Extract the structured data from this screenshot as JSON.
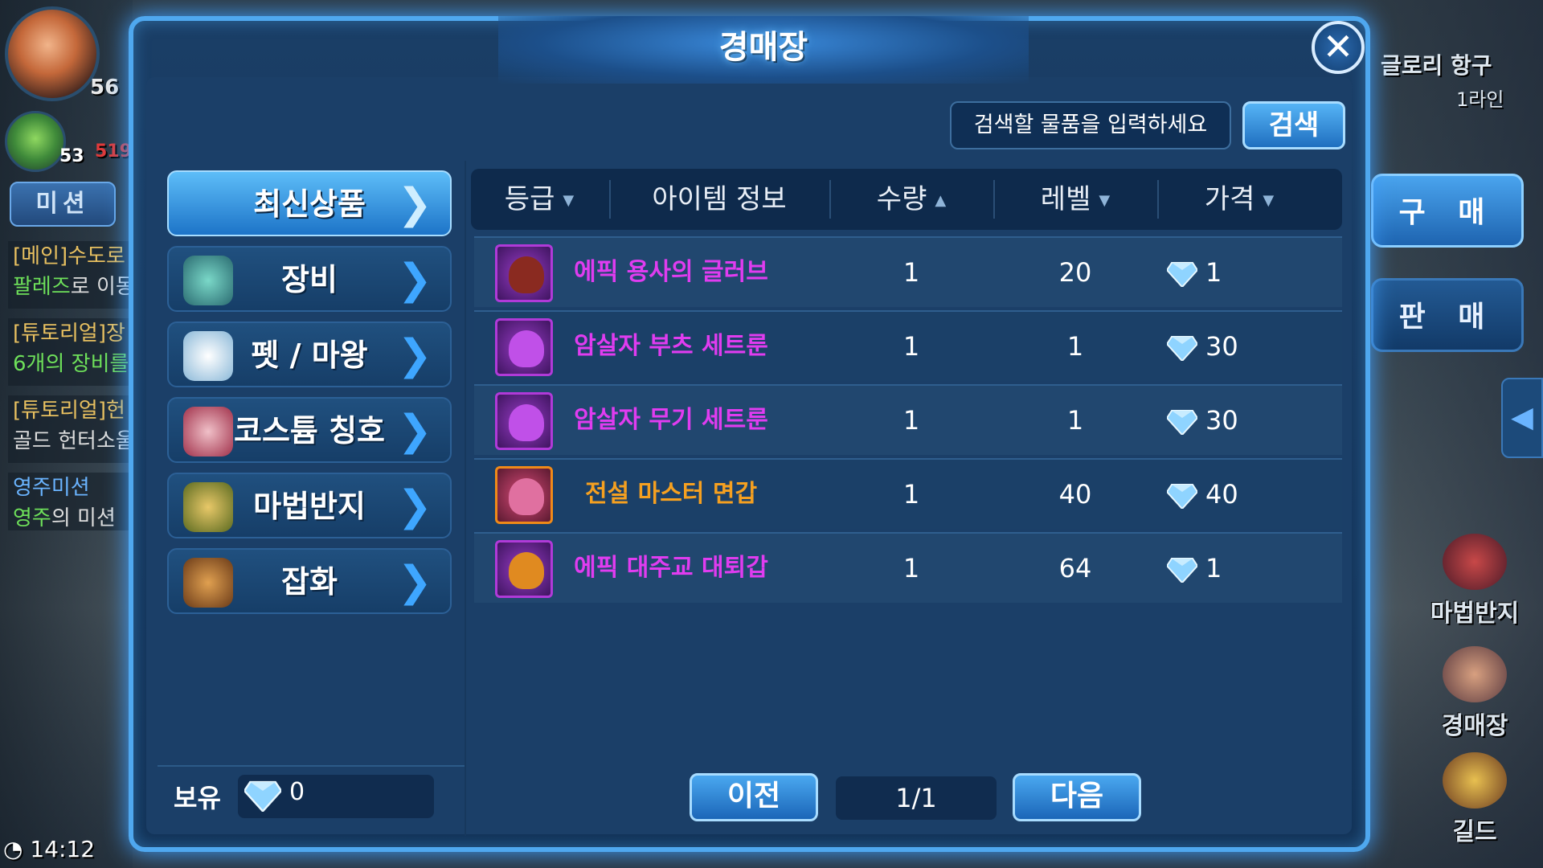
{
  "hud": {
    "player_level": "56",
    "pet_level": "53",
    "pet_hp": "519",
    "mission_label": "미션",
    "quests": [
      {
        "line1": "[메인]수도로",
        "line2a": "팔레즈",
        "line2b": "로 이동"
      },
      {
        "line1": "[튜토리얼]장",
        "line2a": "6개의 장비를",
        "line2b": ""
      },
      {
        "line1": "[튜토리얼]헌",
        "line2a": "골드 헌터소울",
        "line2b": ""
      },
      {
        "line1": "영주미션",
        "line2a": "영주",
        "line2b": "의 미션"
      }
    ],
    "clock": "14:12",
    "location": "글로리 항구",
    "channel": "1라인",
    "side_tabs": {
      "buy": "구 매",
      "sell": "판 매"
    },
    "shortcuts": [
      "마법반지",
      "경매장",
      "길드"
    ]
  },
  "auction": {
    "title": "경매장",
    "search": {
      "placeholder": "검색할 물품을 입력하세요",
      "button": "검색"
    },
    "categories": [
      {
        "label": "최신상품",
        "active": true
      },
      {
        "label": "장비",
        "icon": "armor-icon"
      },
      {
        "label": "펫 / 마왕",
        "icon": "pet-icon"
      },
      {
        "label": "코스튬 칭호",
        "icon": "costume-icon"
      },
      {
        "label": "마법반지",
        "icon": "helmet-icon"
      },
      {
        "label": "잡화",
        "icon": "chest-icon"
      }
    ],
    "columns": {
      "grade": "등급",
      "info": "아이템 정보",
      "qty": "수량",
      "level": "레벨",
      "price": "가격"
    },
    "column_arrows": {
      "grade": "▼",
      "qty": "▲",
      "level": "▼",
      "price": "▼"
    },
    "items": [
      {
        "name": "에픽 용사의 글러브",
        "qty": "1",
        "level": "20",
        "price": "1",
        "rarity": "epic",
        "color": "#e03cf0"
      },
      {
        "name": "암살자 부츠 세트룬",
        "qty": "1",
        "level": "1",
        "price": "30",
        "rarity": "epic",
        "color": "#e03cf0"
      },
      {
        "name": "암살자 무기 세트룬",
        "qty": "1",
        "level": "1",
        "price": "30",
        "rarity": "epic",
        "color": "#e03cf0"
      },
      {
        "name": "전설 마스터 면갑",
        "qty": "1",
        "level": "40",
        "price": "40",
        "rarity": "legend",
        "color": "#f5a020"
      },
      {
        "name": "에픽 대주교 대퇴갑",
        "qty": "1",
        "level": "64",
        "price": "1",
        "rarity": "epic",
        "color": "#e03cf0"
      }
    ],
    "owned": {
      "label": "보유",
      "value": "0"
    },
    "pagination": {
      "prev": "이전",
      "page": "1/1",
      "next": "다음"
    }
  },
  "colors": {
    "epic": "#e03cf0",
    "legend": "#f5a020",
    "accent": "#4fa8ef"
  }
}
